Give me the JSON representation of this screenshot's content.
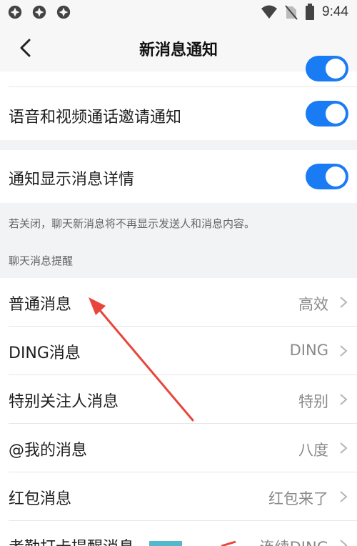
{
  "status_bar": {
    "time": "9:44",
    "left_icons": [
      "app-notification-icon",
      "app-notification-icon",
      "app-notification-icon"
    ],
    "right_icons": [
      "wifi-icon",
      "no-sim-icon",
      "battery-icon"
    ]
  },
  "nav": {
    "title": "新消息通知",
    "back_icon": "chevron-left-icon"
  },
  "settings": {
    "voice_video_invite": {
      "label": "语音和视频通话邀请通知",
      "enabled": true
    },
    "show_details": {
      "label": "通知显示消息详情",
      "enabled": true
    },
    "show_details_hint": "若关闭，聊天新消息将不再显示发送人和消息内容。",
    "section_header": "聊天消息提醒"
  },
  "chat_reminders": [
    {
      "label": "普通消息",
      "value": "高效"
    },
    {
      "label": "DING消息",
      "value": "DING"
    },
    {
      "label": "特别关注人消息",
      "value": "特别"
    },
    {
      "label": "@我的消息",
      "value": "八度"
    },
    {
      "label": "红包消息",
      "value": "红包来了"
    },
    {
      "label": "考勤打卡提醒消息",
      "value": "连续DING"
    }
  ],
  "colors": {
    "accent": "#1a7cf5",
    "background": "#f2f3f5",
    "annotation_arrow": "#e8453c",
    "annotation_box": "#53b8cc"
  }
}
